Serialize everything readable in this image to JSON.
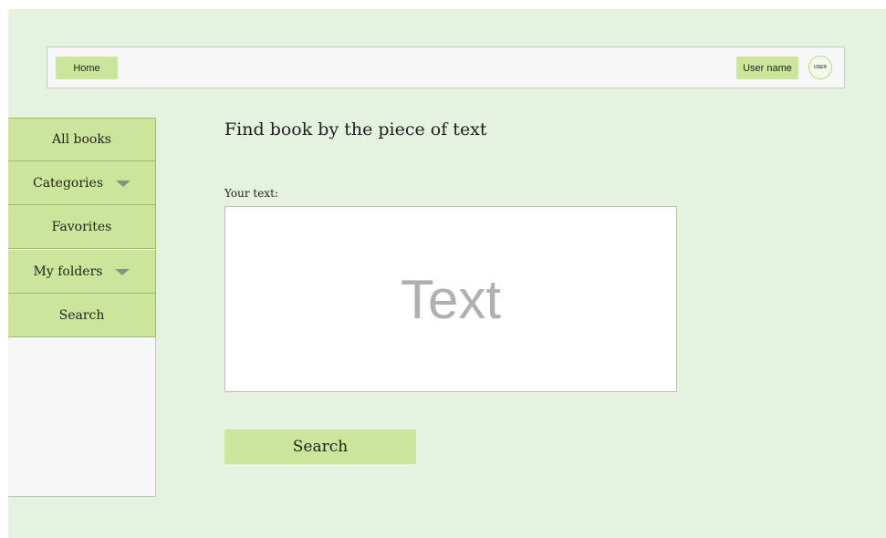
{
  "header": {
    "home_label": "Home",
    "username_label": "User name",
    "avatar_text": "USER"
  },
  "sidebar": {
    "items": [
      {
        "label": "All books",
        "has_dropdown": false
      },
      {
        "label": "Categories",
        "has_dropdown": true
      },
      {
        "label": "Favorites",
        "has_dropdown": false
      },
      {
        "label": "My folders",
        "has_dropdown": true
      },
      {
        "label": "Search",
        "has_dropdown": false
      }
    ]
  },
  "main": {
    "title": "Find book by the piece of text",
    "field_label": "Your text:",
    "text_value": "Text",
    "search_button_label": "Search"
  },
  "colors": {
    "background": "#e6f2e0",
    "accent": "#cbe69a",
    "panel": "#f7f7f7"
  }
}
